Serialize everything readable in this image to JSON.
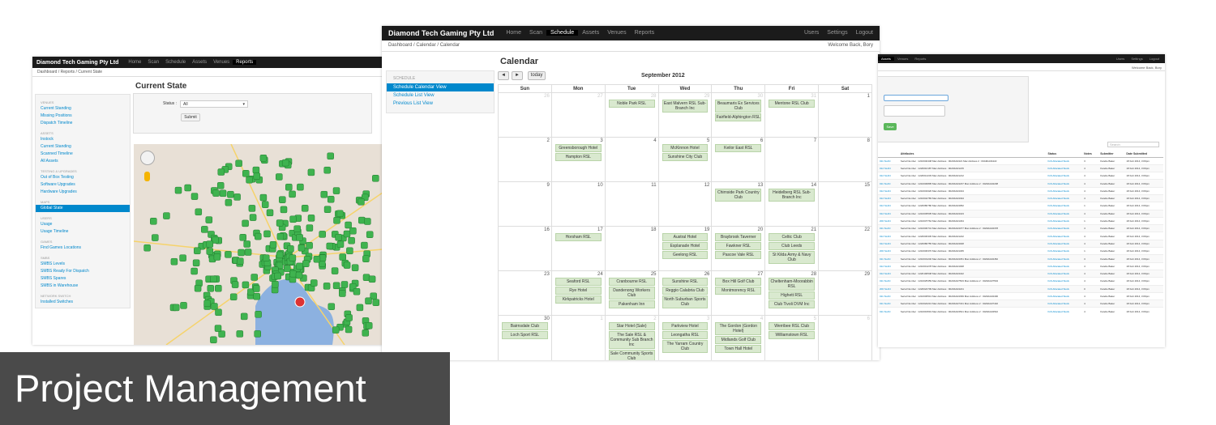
{
  "s1": {
    "brand": "Diamond Tech Gaming Pty Ltd",
    "nav": [
      "Home",
      "Scan",
      "Schedule",
      "Assets",
      "Venues",
      "Reports"
    ],
    "active_nav": 5,
    "breadcrumb": "Dashboard / Reports / Current State",
    "title": "Current State",
    "status_label": "Status :",
    "status_value": "All",
    "submit": "Submit",
    "sidebar": [
      {
        "header": "Venues",
        "items": [
          "Current Standing",
          "Missing Positions",
          "Dispatch Timeline"
        ]
      },
      {
        "header": "Assets",
        "items": [
          "Instock",
          "Current Standing",
          "Scanned Timeline",
          "All Assets"
        ]
      },
      {
        "header": "Testing & Upgrades",
        "items": [
          "Out of Box Testing",
          "Software Upgrades",
          "Hardware Upgrades"
        ]
      },
      {
        "header": "Maps",
        "items": [
          "Global State"
        ]
      },
      {
        "header": "Users",
        "items": [
          "Usage",
          "Usage Timeline"
        ]
      },
      {
        "header": "Games",
        "items": [
          "Find Games Locations"
        ]
      },
      {
        "header": "SMBS",
        "items": [
          "SMBS Levels",
          "SMBS Ready For Dispatch",
          "SMBS Spares",
          "SMBS in Warehouse"
        ]
      },
      {
        "header": "Network Switch",
        "items": [
          "Installed Switches"
        ]
      }
    ],
    "active_side": "Global State",
    "map_colors": {
      "land": "#e8e0d6",
      "water": "#8cb1e0",
      "marker": "#3fb34f"
    }
  },
  "s2": {
    "brand": "Diamond Tech Gaming Pty Ltd",
    "nav": [
      "Home",
      "Scan",
      "Schedule",
      "Assets",
      "Venues",
      "Reports"
    ],
    "active_nav": 2,
    "nav_right": [
      "Users",
      "Settings",
      "Logout"
    ],
    "breadcrumb": "Dashboard / Calendar / Calendar",
    "welcome": "Welcome Back, Bory",
    "title": "Calendar",
    "prev": "◄",
    "next": "►",
    "today": "today",
    "month": "September 2012",
    "sidebar_header": "Schedule",
    "sidebar": [
      "Schedule Calendar View",
      "Schedule List View",
      "Previous List View"
    ],
    "days": [
      "Sun",
      "Mon",
      "Tue",
      "Wed",
      "Thu",
      "Fri",
      "Sat"
    ],
    "weeks": [
      [
        {
          "d": "26",
          "o": true,
          "e": []
        },
        {
          "d": "27",
          "o": true,
          "e": []
        },
        {
          "d": "28",
          "o": true,
          "e": [
            "Noble Park RSL"
          ]
        },
        {
          "d": "29",
          "o": true,
          "e": [
            "East Malvern RSL Sub-Branch Inc"
          ]
        },
        {
          "d": "30",
          "o": true,
          "e": [
            "Beaumaris Ex Services Club",
            "Fairfield-Alphington RSL"
          ]
        },
        {
          "d": "31",
          "o": true,
          "e": [
            "Mentone RSL Club"
          ]
        },
        {
          "d": "1",
          "e": []
        }
      ],
      [
        {
          "d": "2",
          "e": []
        },
        {
          "d": "3",
          "e": [
            "Greensborough Hotel",
            "Hampton RSL"
          ]
        },
        {
          "d": "4",
          "e": []
        },
        {
          "d": "5",
          "e": [
            "McKinnon Hotel",
            "Sunshine City Club"
          ]
        },
        {
          "d": "6",
          "e": [
            "Keilor East RSL"
          ]
        },
        {
          "d": "7",
          "e": []
        },
        {
          "d": "8",
          "e": []
        }
      ],
      [
        {
          "d": "9",
          "e": []
        },
        {
          "d": "10",
          "e": []
        },
        {
          "d": "11",
          "e": []
        },
        {
          "d": "12",
          "e": []
        },
        {
          "d": "13",
          "e": [
            "Chirnside Park Country Club"
          ]
        },
        {
          "d": "14",
          "e": [
            "Heidelberg RSL Sub-Branch Inc"
          ]
        },
        {
          "d": "15",
          "e": []
        }
      ],
      [
        {
          "d": "16",
          "e": []
        },
        {
          "d": "17",
          "e": [
            "Horsham RSL"
          ]
        },
        {
          "d": "18",
          "e": []
        },
        {
          "d": "19",
          "e": [
            "Austral Hotel",
            "Esplanade Hotel",
            "Geelong RSL"
          ]
        },
        {
          "d": "20",
          "e": [
            "Braybrook Taverner",
            "Fawkner RSL",
            "Pascoe Vale RSL"
          ]
        },
        {
          "d": "21",
          "e": [
            "Celtic Club",
            "Club Leeds",
            "St Kilda Army & Navy Club"
          ]
        },
        {
          "d": "22",
          "e": []
        }
      ],
      [
        {
          "d": "23",
          "e": []
        },
        {
          "d": "24",
          "e": [
            "Seaford RSL",
            "Rye Hotel",
            "Kirkpatricks Hotel"
          ]
        },
        {
          "d": "25",
          "e": [
            "Cranbourne RSL",
            "Dandenong Workers Club",
            "Pakenham Inn"
          ]
        },
        {
          "d": "26",
          "e": [
            "Sunshine RSL",
            "Reggio Calabria Club",
            "North Suburban Sports Club"
          ]
        },
        {
          "d": "27",
          "e": [
            "Box Hill Golf Club",
            "Montmorency RSL"
          ]
        },
        {
          "d": "28",
          "e": [
            "Cheltenham-Moorabbin RSL",
            "Highett RSL",
            "Club Tivoli DVM Inc"
          ]
        },
        {
          "d": "29",
          "e": []
        }
      ],
      [
        {
          "d": "30",
          "e": [
            "Bairnsdale Club",
            "Loch Sport RSL"
          ]
        },
        {
          "d": "1",
          "o": true,
          "e": []
        },
        {
          "d": "2",
          "o": true,
          "e": [
            "Star Hotel (Sale)",
            "The Sale RSL & Community Sub Branch Inc",
            "Sale Community Sports Club"
          ]
        },
        {
          "d": "3",
          "o": true,
          "e": [
            "Parkview Hotel",
            "Leongatha RSL",
            "The Yarram Country Club"
          ]
        },
        {
          "d": "4",
          "o": true,
          "e": [
            "The Gordon (Gordon Hotel)",
            "Midlands Golf Club",
            "Town Hall Hotel"
          ]
        },
        {
          "d": "5",
          "o": true,
          "e": [
            "Werribee RSL Club",
            "Williamstown RSL"
          ]
        },
        {
          "d": "6",
          "o": true,
          "e": []
        }
      ]
    ],
    "event_color": "#d9e9cf"
  },
  "s3": {
    "nav": [
      "Assets",
      "Venues",
      "Reports"
    ],
    "nav_right": [
      "Users",
      "Settings",
      "Logout"
    ],
    "welcome": "Welcome Back, Bory",
    "save": "Save",
    "search_placeholder": "Search",
    "columns": [
      "",
      "Attributes",
      "Status",
      "Notes",
      "Submitter",
      "Date Submitted"
    ],
    "rows": [
      [
        "011 SLAN",
        "Serial Number : 1210040448 Mac Address : 00A9bA0421 Mac Address 2 : 00A9bA04422",
        "IGS Allocated Stock",
        "3",
        "Karelle Baker",
        "18 Feb 2014, 3:09pm"
      ],
      [
        "012 SLAN",
        "Serial Number : 1220010187 Mac Address : 00A9bA01215",
        "IGS Allocated Stock",
        "4",
        "Karelle Baker",
        "18 Feb 2014, 3:09pm"
      ],
      [
        "012 SLAN",
        "Serial Number : 1220014233 Mac Address : 00A9bA01212",
        "IGS Allocated Stock",
        "4",
        "Karelle Baker",
        "18 Feb 2014, 3:09pm"
      ],
      [
        "011 SLAN",
        "Serial Number : 1210030805 Mac Address : 00A9bA04237 Mac Address 2 : 00A9bA04238",
        "IGS Allocated Stock",
        "4",
        "Karelle Baker",
        "18 Feb 2014, 3:09pm"
      ],
      [
        "012 SLAN",
        "Serial Number : 1210043320 Mac Address : 00A9bA04324",
        "IGS Allocated Stock",
        "4",
        "Karelle Baker",
        "18 Feb 2014, 3:09pm"
      ],
      [
        "012 SLAN",
        "Serial Number : 1210042783 Mac Address : 00A9bA04494",
        "IGS Allocated Stock",
        "4",
        "Karelle Baker",
        "18 Feb 2014, 3:09pm"
      ],
      [
        "012 SLAN",
        "Serial Number : 1220080780 Mac Address : 00A9bA04952",
        "IGS Allocated Stock",
        "1",
        "Karelle Baker",
        "18 Feb 2014, 3:09pm"
      ],
      [
        "012 SLAN",
        "Serial Number : 1210045535 Mac Address : 00A9bA04423",
        "IGS Allocated Stock",
        "4",
        "Karelle Baker",
        "18 Feb 2014, 3:09pm"
      ],
      [
        "200 SLAN",
        "Serial Number : 1210037764 Mac Address : 00A9bA01464",
        "IGS Allocated Stock",
        "1",
        "Karelle Baker",
        "18 Feb 2014, 3:09pm"
      ],
      [
        "011 SLAN",
        "Serial Number : 1210030741 Mac Address : 00A9bA04377 Mac Address 2 : 00A9bA04378",
        "IGS Allocated Stock",
        "4",
        "Karelle Baker",
        "18 Feb 2014, 3:09pm"
      ],
      [
        "012 SLAN",
        "Serial Number : 1220030345 Mac Address : 00A9bA01222",
        "IGS Allocated Stock",
        "4",
        "Karelle Baker",
        "18 Feb 2014, 3:09pm"
      ],
      [
        "012 SLAN",
        "Serial Number : 1220080755 Mac Address : 00A9bA04948",
        "IGS Allocated Stock",
        "4",
        "Karelle Baker",
        "18 Feb 2014, 3:09pm"
      ],
      [
        "200 SLAN",
        "Serial Number : 1210030370 Mac Address : 00A9bA01465",
        "IGS Allocated Stock",
        "1",
        "Karelle Baker",
        "18 Feb 2014, 3:09pm"
      ],
      [
        "011 SLAN",
        "Serial Number : 1210031240 Mac Address : 00A9bA04451 Mac Address 2 : 00A9bA04452",
        "IGS Allocated Stock",
        "3",
        "Karelle Baker",
        "18 Feb 2014, 3:09pm"
      ],
      [
        "012 SLAN",
        "Serial Number : 1210013278 Mac Address : 00A9bA01948",
        "IGS Allocated Stock",
        "4",
        "Karelle Baker",
        "18 Feb 2014, 3:09pm"
      ],
      [
        "012 SLAN",
        "Serial Number : 1220100548 Mac Address : 00A9bA04442",
        "IGS Allocated Stock",
        "4",
        "Karelle Baker",
        "18 Feb 2014, 3:09pm"
      ],
      [
        "011 SLAN",
        "Serial Number : 1210025359 Mac Address : 00A9bA07503 Mac Address 2 : 00A9bA07504",
        "IGS Allocated Stock",
        "4",
        "Karelle Baker",
        "18 Feb 2014, 3:09pm"
      ],
      [
        "200 SLAN",
        "Serial Number : 1220022709 Mac Address : 00A9bA04221",
        "IGS Allocated Stock",
        "0",
        "Karelle Baker",
        "18 Feb 2014, 3:09pm"
      ],
      [
        "011 SLAN",
        "Serial Number : 1210030513 Mac Address : 00A9bA04399 Mac Address 2 : 00A9bA04400",
        "IGS Allocated Stock",
        "4",
        "Karelle Baker",
        "18 Feb 2014, 3:09pm"
      ],
      [
        "011 SLAN",
        "Serial Number : 1210022213 Mac Address : 00A9bA07431 Mac Address 2 : 00A9bA07432",
        "IGS Allocated Stock",
        "4",
        "Karelle Baker",
        "18 Feb 2014, 3:09pm"
      ],
      [
        "011 SLAN",
        "Serial Number : 1210019519 Mac Address : 00A9bA04541 Mac Address 2 : 00A9bA04542",
        "IGS Allocated Stock",
        "4",
        "Karelle Baker",
        "18 Feb 2014, 3:09pm"
      ]
    ]
  },
  "banner": {
    "text": "Project Management",
    "bg": "#4a4a4a"
  }
}
